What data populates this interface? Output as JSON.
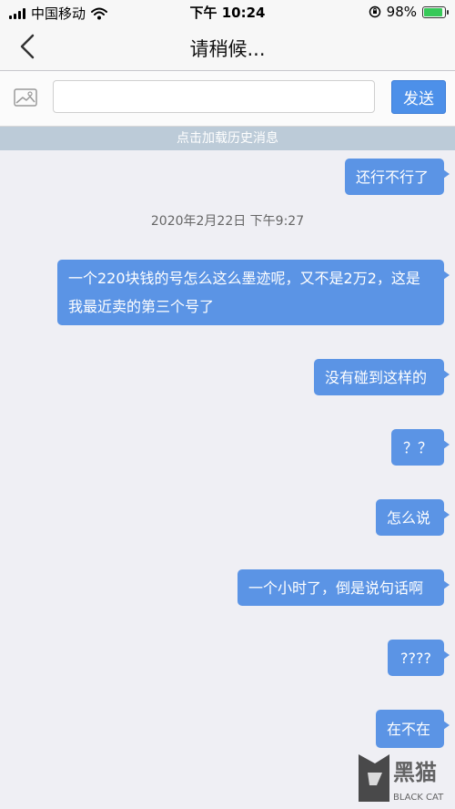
{
  "status_bar": {
    "carrier": "中国移动",
    "time": "下午 10:24",
    "battery": "98%",
    "battery_level": 0.98
  },
  "nav": {
    "title": "请稍候..."
  },
  "input_bar": {
    "input_value": "",
    "input_placeholder": "",
    "send_label": "发送"
  },
  "load_history_label": "点击加载历史消息",
  "messages": [
    {
      "text": "还行不行了"
    },
    {
      "text": "一个220块钱的号怎么这么墨迹呢，又不是2万2，这是我最近卖的第三个号了"
    },
    {
      "text": "没有碰到这样的"
    },
    {
      "text": "？？"
    },
    {
      "text": "怎么说"
    },
    {
      "text": "一个小时了，倒是说句话啊"
    },
    {
      "text": "????"
    },
    {
      "text": "在不在"
    }
  ],
  "timestamp": "2020年2月22日 下午9:27",
  "watermark": {
    "main": "黑猫",
    "sub": "BLACK CAT"
  },
  "colors": {
    "bubble": "#5b94e5",
    "send_button": "#4d90e9",
    "history_bar": "#bccbd8",
    "background": "#efeff4"
  }
}
